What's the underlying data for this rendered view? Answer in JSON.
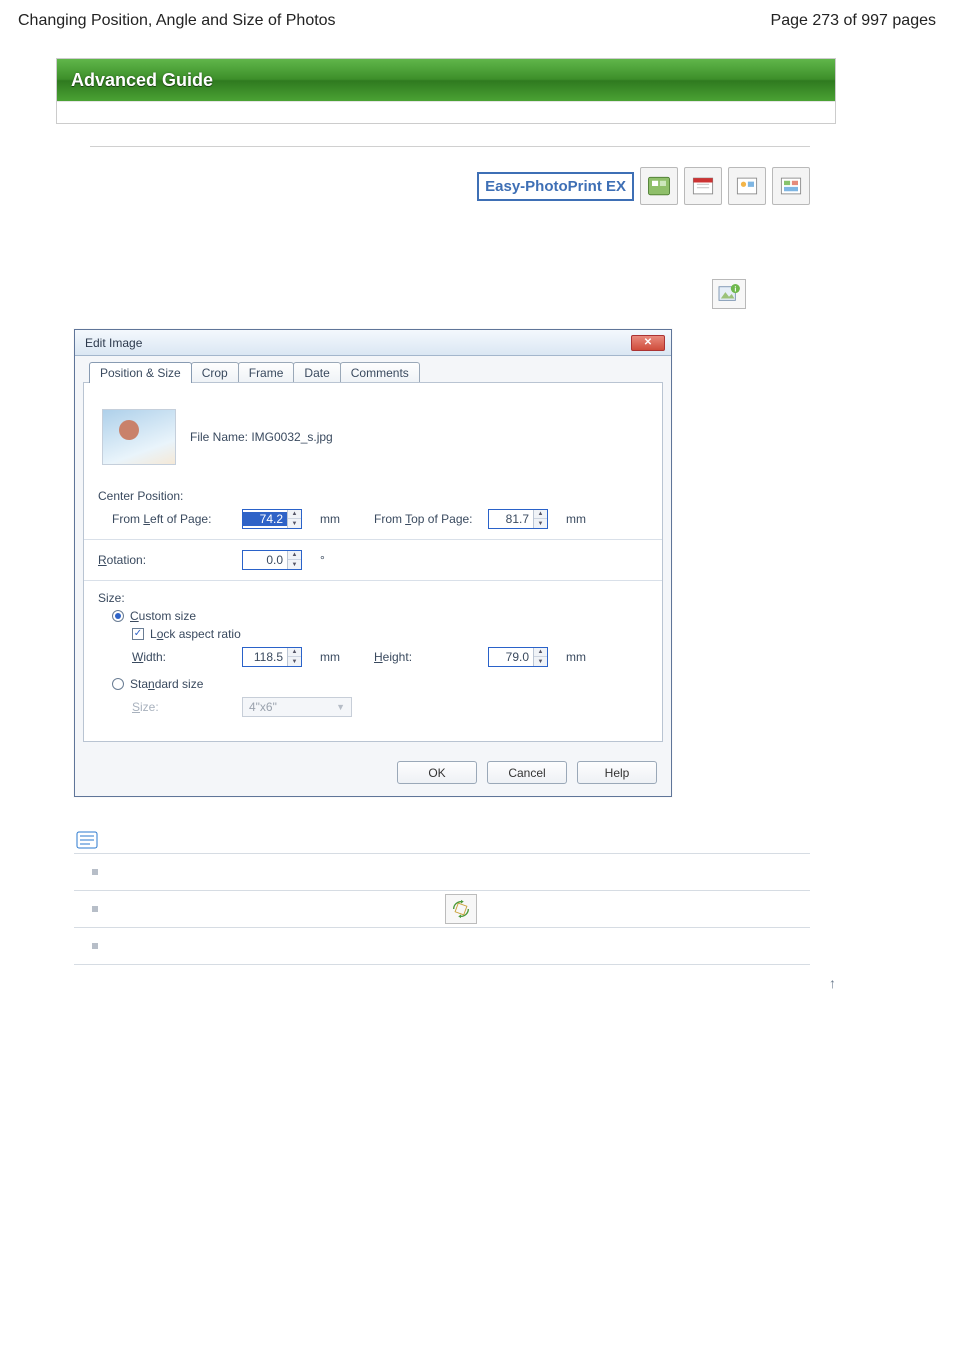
{
  "header": {
    "title": "Changing Position, Angle and Size of Photos",
    "page_indicator": "Page 273 of 997 pages"
  },
  "advanced_guide_label": "Advanced Guide",
  "epp_label": "Easy-PhotoPrint EX",
  "dialog": {
    "title": "Edit Image",
    "tabs": {
      "position_size": "Position & Size",
      "crop": "Crop",
      "frame": "Frame",
      "date": "Date",
      "comments": "Comments"
    },
    "file_name_label": "File Name: IMG0032_s.jpg",
    "center_position_label": "Center Position:",
    "from_left_label": "From Left of Page:",
    "from_left_value": "74.2",
    "from_top_label": "From Top of Page:",
    "from_top_value": "81.7",
    "rotation_label": "Rotation:",
    "rotation_value": "0.0",
    "rotation_unit": "°",
    "size_label": "Size:",
    "custom_size_label": "Custom size",
    "lock_aspect_label": "Lock aspect ratio",
    "width_label": "Width:",
    "width_value": "118.5",
    "height_label": "Height:",
    "height_value": "79.0",
    "standard_size_label": "Standard size",
    "std_size_label": "Size:",
    "std_size_value": "4\"x6\"",
    "unit_mm": "mm",
    "buttons": {
      "ok": "OK",
      "cancel": "Cancel",
      "help": "Help"
    }
  },
  "page_top_symbol": "↑"
}
